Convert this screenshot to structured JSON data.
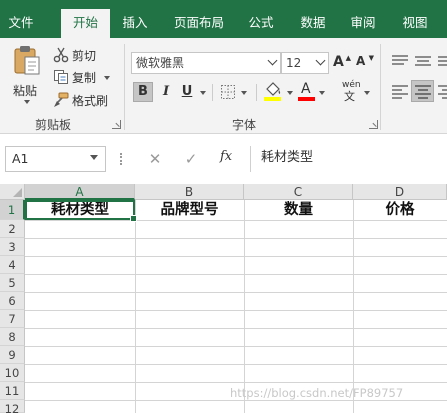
{
  "menu": {
    "tabs": [
      "文件",
      "开始",
      "插入",
      "页面布局",
      "公式",
      "数据",
      "审阅",
      "视图"
    ],
    "active": "开始"
  },
  "ribbon": {
    "clipboard": {
      "paste_label": "粘贴",
      "cut_label": "剪切",
      "copy_label": "复制",
      "format_painter_label": "格式刷",
      "group_label": "剪贴板"
    },
    "font": {
      "font_name": "微软雅黑",
      "font_size": "12",
      "bold": "B",
      "italic": "I",
      "underline": "U",
      "group_label": "字体",
      "grow_icon": "A",
      "shrink_icon": "A",
      "font_color_icon": "A",
      "phonetic_icon": "wén"
    }
  },
  "formula_bar": {
    "name_box": "A1",
    "cancel_icon": "✕",
    "enter_icon": "✓",
    "fx_label": "fx",
    "content": "耗材类型"
  },
  "sheet": {
    "columns": [
      "A",
      "B",
      "C",
      "D"
    ],
    "rows": [
      "1",
      "2",
      "3",
      "4",
      "5",
      "6",
      "7",
      "8",
      "9",
      "10",
      "11",
      "12"
    ],
    "row1": [
      "耗材类型",
      "品牌型号",
      "数量",
      "价格"
    ],
    "selected_cell": "A1"
  },
  "watermark": "https://blog.csdn.net/FP89757",
  "colors": {
    "accent": "#217346",
    "font_highlight": "#ffff00",
    "font_color": "#ff0000"
  }
}
